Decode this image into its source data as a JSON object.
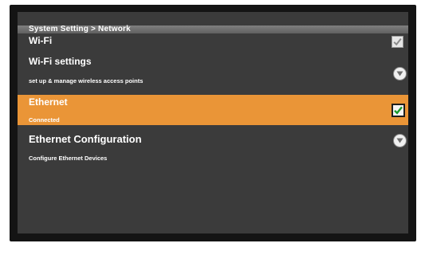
{
  "header": {
    "title": "System Setting > Network"
  },
  "items": [
    {
      "label": "Wi-Fi",
      "checked": true,
      "control": "checkbox"
    },
    {
      "label": "Wi-Fi settings",
      "description": "set up & manage wireless access points",
      "control": "chevron-down"
    },
    {
      "label": "Ethernet",
      "description": "Connected",
      "checked": true,
      "control": "checkbox",
      "selected": true
    },
    {
      "label": "Ethernet Configuration",
      "description": "Configure Ethernet Devices",
      "control": "chevron-down"
    }
  ],
  "colors": {
    "highlight": "#ea9537",
    "background": "#3b3b3b",
    "bezel": "#141414",
    "check_active": "#1a9a2a",
    "check_inactive": "#8a8a8a"
  }
}
